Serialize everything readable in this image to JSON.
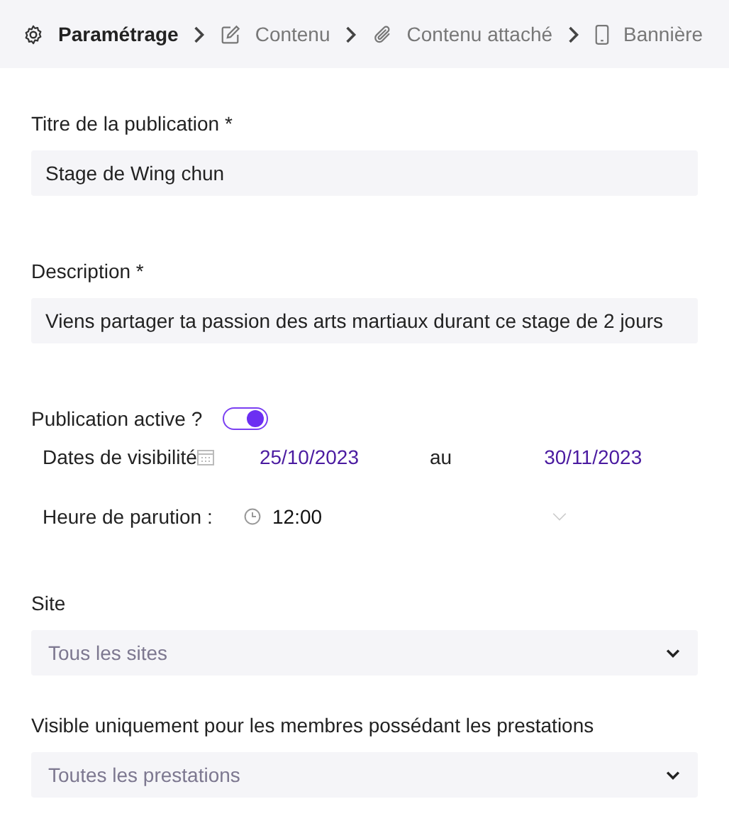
{
  "steps": [
    {
      "label": "Paramétrage",
      "selected": true
    },
    {
      "label": "Contenu",
      "selected": false
    },
    {
      "label": "Contenu attaché",
      "selected": false
    },
    {
      "label": "Bannière",
      "selected": false
    }
  ],
  "title_field": {
    "label": "Titre de la publication *",
    "value": "Stage de Wing chun"
  },
  "description_field": {
    "label": "Description *",
    "value": "Viens partager ta passion des arts martiaux durant ce stage de 2 jours"
  },
  "active_toggle": {
    "label": "Publication active ?",
    "on": true
  },
  "visibility": {
    "label": "Dates de visibilité",
    "start": "25/10/2023",
    "separator": "au",
    "end": "30/11/2023"
  },
  "time": {
    "label": "Heure de parution :",
    "value": "12:00"
  },
  "selects": [
    {
      "label": "Site",
      "placeholder": "Tous les sites"
    },
    {
      "label": "Visible uniquement pour les membres possédant les prestations",
      "placeholder": "Toutes les prestations"
    }
  ]
}
